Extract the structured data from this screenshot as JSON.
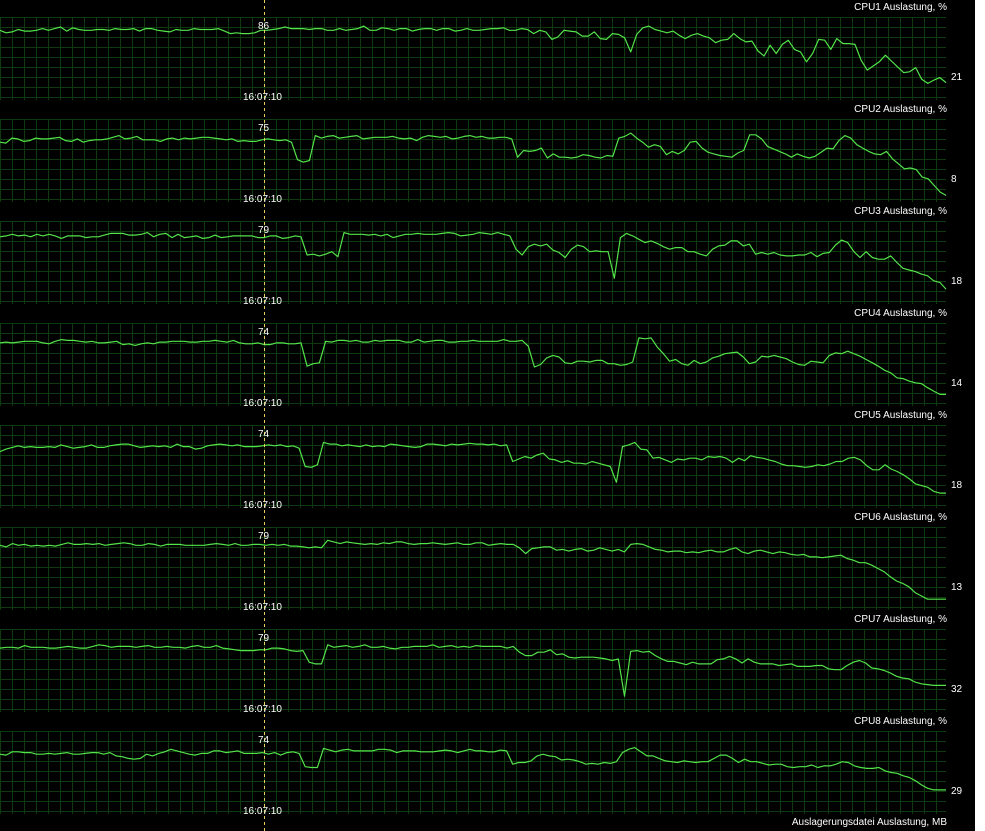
{
  "colors": {
    "background": "#000000",
    "grid": "#0f3a0f",
    "line": "#53e34a",
    "cursor": "#e8d060",
    "text": "#ffffff"
  },
  "cursor_time": "16:07:10",
  "panels": [
    {
      "title": "CPU1 Auslastung, %",
      "cursor_value": "86",
      "current_value": "21",
      "values": [
        84,
        81,
        82,
        85,
        83,
        83,
        84,
        86,
        84,
        86,
        88,
        83,
        87,
        85,
        84,
        84,
        85,
        85,
        84,
        86,
        85,
        85,
        86,
        83,
        86,
        86,
        84,
        83,
        82,
        85,
        84,
        84,
        86,
        85,
        85,
        85,
        86,
        83,
        80,
        81,
        80,
        80,
        81,
        84,
        84,
        85,
        86,
        88,
        86,
        86,
        86,
        85,
        86,
        86,
        84,
        84,
        86,
        84,
        85,
        86,
        89,
        84,
        84,
        87,
        86,
        84,
        86,
        86,
        83,
        85,
        86,
        86,
        84,
        86,
        86,
        83,
        84,
        86,
        84,
        84,
        85,
        86,
        86,
        87,
        84,
        84,
        86,
        85,
        80,
        84,
        82,
        73,
        76,
        84,
        83,
        82,
        77,
        77,
        82,
        74,
        73,
        80,
        79,
        75,
        58,
        79,
        87,
        89,
        85,
        83,
        81,
        83,
        78,
        74,
        78,
        80,
        77,
        75,
        69,
        72,
        73,
        80,
        74,
        70,
        71,
        59,
        53,
        66,
        56,
        67,
        72,
        61,
        58,
        46,
        56,
        73,
        72,
        61,
        74,
        68,
        68,
        67,
        48,
        36,
        41,
        46,
        54,
        47,
        40,
        33,
        34,
        39,
        25,
        20,
        24,
        27,
        21
      ]
    },
    {
      "title": "CPU2 Auslastung, %",
      "cursor_value": "75",
      "current_value": "8",
      "values": [
        72,
        71,
        77,
        76,
        73,
        74,
        77,
        76,
        76,
        77,
        78,
        74,
        73,
        76,
        72,
        74,
        75,
        75,
        76,
        78,
        80,
        76,
        77,
        79,
        75,
        75,
        75,
        73,
        76,
        77,
        75,
        77,
        76,
        77,
        78,
        78,
        77,
        76,
        75,
        76,
        73,
        74,
        73,
        73,
        75,
        76,
        75,
        74,
        75,
        72,
        51,
        48,
        50,
        80,
        77,
        79,
        80,
        77,
        78,
        79,
        80,
        76,
        77,
        78,
        78,
        78,
        79,
        77,
        76,
        77,
        74,
        78,
        80,
        79,
        78,
        79,
        76,
        77,
        79,
        80,
        78,
        79,
        77,
        77,
        78,
        78,
        76,
        54,
        62,
        61,
        62,
        65,
        53,
        58,
        54,
        54,
        53,
        54,
        57,
        56,
        54,
        53,
        56,
        55,
        77,
        79,
        83,
        77,
        72,
        66,
        69,
        67,
        57,
        61,
        58,
        62,
        72,
        73,
        65,
        60,
        58,
        56,
        55,
        54,
        59,
        62,
        81,
        81,
        76,
        67,
        64,
        61,
        58,
        54,
        58,
        55,
        53,
        55,
        60,
        65,
        64,
        74,
        80,
        77,
        69,
        65,
        61,
        58,
        57,
        61,
        52,
        46,
        40,
        41,
        39,
        30,
        28,
        20,
        12,
        8
      ]
    },
    {
      "title": "CPU3 Auslastung, %",
      "cursor_value": "79",
      "current_value": "18",
      "values": [
        81,
        82,
        84,
        82,
        83,
        81,
        84,
        82,
        84,
        82,
        79,
        82,
        82,
        82,
        80,
        81,
        81,
        83,
        85,
        85,
        85,
        83,
        83,
        84,
        86,
        81,
        84,
        85,
        80,
        84,
        80,
        81,
        82,
        79,
        80,
        83,
        80,
        81,
        82,
        82,
        82,
        82,
        80,
        80,
        82,
        82,
        79,
        80,
        82,
        81,
        59,
        60,
        58,
        60,
        63,
        57,
        86,
        84,
        84,
        84,
        83,
        84,
        82,
        84,
        80,
        82,
        84,
        84,
        85,
        84,
        84,
        84,
        85,
        86,
        85,
        82,
        83,
        84,
        86,
        85,
        84,
        86,
        84,
        82,
        66,
        59,
        69,
        72,
        70,
        72,
        65,
        62,
        56,
        66,
        71,
        69,
        63,
        64,
        63,
        63,
        31,
        80,
        85,
        82,
        78,
        74,
        76,
        73,
        69,
        66,
        68,
        68,
        63,
        63,
        60,
        58,
        66,
        70,
        71,
        76,
        76,
        70,
        72,
        60,
        62,
        60,
        62,
        59,
        58,
        58,
        59,
        59,
        62,
        57,
        61,
        62,
        71,
        77,
        74,
        63,
        56,
        63,
        56,
        54,
        54,
        58,
        50,
        43,
        41,
        39,
        36,
        34,
        28,
        26,
        18
      ]
    },
    {
      "title": "CPU4 Auslastung, %",
      "cursor_value": "74",
      "current_value": "14",
      "values": [
        76,
        77,
        76,
        77,
        78,
        78,
        78,
        76,
        75,
        78,
        80,
        79,
        79,
        78,
        77,
        78,
        76,
        76,
        77,
        78,
        74,
        75,
        73,
        75,
        76,
        75,
        77,
        77,
        78,
        78,
        78,
        77,
        77,
        78,
        78,
        79,
        78,
        77,
        79,
        76,
        75,
        75,
        76,
        74,
        74,
        76,
        76,
        75,
        75,
        76,
        48,
        51,
        52,
        78,
        77,
        79,
        79,
        78,
        79,
        77,
        77,
        79,
        78,
        79,
        79,
        79,
        77,
        77,
        80,
        77,
        78,
        79,
        79,
        77,
        77,
        78,
        78,
        79,
        78,
        78,
        78,
        78,
        80,
        78,
        78,
        79,
        72,
        47,
        50,
        58,
        61,
        59,
        52,
        51,
        54,
        54,
        53,
        55,
        55,
        51,
        51,
        49,
        50,
        53,
        82,
        81,
        82,
        71,
        63,
        54,
        56,
        51,
        49,
        55,
        51,
        53,
        58,
        60,
        63,
        64,
        65,
        59,
        51,
        53,
        60,
        59,
        61,
        59,
        57,
        53,
        50,
        49,
        54,
        53,
        52,
        61,
        64,
        63,
        66,
        63,
        60,
        56,
        52,
        48,
        43,
        40,
        34,
        33,
        30,
        28,
        27,
        22,
        18,
        14,
        14
      ]
    },
    {
      "title": "CPU5 Auslastung, %",
      "cursor_value": "74",
      "current_value": "18",
      "values": [
        68,
        71,
        73,
        75,
        73,
        74,
        73,
        73,
        74,
        73,
        76,
        74,
        72,
        73,
        74,
        76,
        73,
        73,
        75,
        76,
        77,
        77,
        75,
        73,
        74,
        75,
        74,
        75,
        73,
        77,
        74,
        74,
        71,
        72,
        75,
        76,
        77,
        76,
        75,
        76,
        74,
        74,
        74,
        75,
        76,
        75,
        76,
        74,
        75,
        72,
        50,
        49,
        52,
        79,
        77,
        77,
        75,
        76,
        75,
        74,
        76,
        74,
        75,
        74,
        77,
        76,
        75,
        74,
        73,
        74,
        77,
        77,
        76,
        75,
        77,
        76,
        77,
        78,
        77,
        77,
        76,
        77,
        75,
        76,
        56,
        59,
        62,
        60,
        64,
        66,
        59,
        58,
        55,
        57,
        54,
        54,
        53,
        56,
        54,
        52,
        50,
        31,
        74,
        76,
        79,
        71,
        70,
        60,
        61,
        58,
        55,
        59,
        58,
        60,
        60,
        58,
        62,
        61,
        62,
        60,
        55,
        60,
        57,
        63,
        61,
        60,
        58,
        56,
        53,
        51,
        51,
        50,
        49,
        50,
        52,
        51,
        53,
        56,
        56,
        60,
        61,
        58,
        51,
        46,
        46,
        52,
        47,
        44,
        40,
        35,
        29,
        27,
        25,
        20,
        18,
        18
      ]
    },
    {
      "title": "CPU6 Auslastung, %",
      "cursor_value": "79",
      "current_value": "13",
      "values": [
        78,
        76,
        80,
        78,
        79,
        77,
        78,
        77,
        78,
        77,
        79,
        81,
        79,
        79,
        80,
        79,
        80,
        78,
        79,
        80,
        81,
        80,
        78,
        78,
        80,
        79,
        77,
        79,
        79,
        79,
        78,
        78,
        78,
        78,
        79,
        80,
        79,
        78,
        80,
        78,
        78,
        79,
        79,
        78,
        79,
        78,
        79,
        77,
        77,
        76,
        75,
        76,
        75,
        84,
        82,
        80,
        82,
        81,
        80,
        79,
        80,
        79,
        81,
        80,
        82,
        82,
        80,
        79,
        80,
        80,
        81,
        80,
        79,
        80,
        81,
        79,
        79,
        81,
        81,
        78,
        79,
        80,
        79,
        79,
        75,
        68,
        74,
        75,
        76,
        76,
        72,
        73,
        71,
        73,
        74,
        71,
        72,
        75,
        73,
        71,
        73,
        70,
        79,
        80,
        79,
        76,
        73,
        72,
        70,
        71,
        71,
        69,
        70,
        69,
        71,
        72,
        70,
        70,
        73,
        75,
        70,
        68,
        71,
        72,
        70,
        68,
        70,
        69,
        67,
        66,
        67,
        64,
        64,
        63,
        64,
        65,
        66,
        62,
        60,
        57,
        57,
        54,
        50,
        46,
        40,
        35,
        32,
        28,
        21,
        17,
        13,
        13,
        13,
        13
      ]
    },
    {
      "title": "CPU7 Auslastung, %",
      "cursor_value": "79",
      "current_value": "32",
      "values": [
        77,
        78,
        78,
        77,
        80,
        78,
        78,
        78,
        77,
        77,
        78,
        79,
        78,
        77,
        77,
        79,
        81,
        80,
        78,
        79,
        79,
        79,
        78,
        79,
        80,
        78,
        78,
        79,
        78,
        78,
        77,
        79,
        80,
        78,
        78,
        80,
        77,
        76,
        75,
        74,
        74,
        74,
        75,
        75,
        77,
        77,
        76,
        74,
        73,
        74,
        60,
        58,
        58,
        81,
        78,
        79,
        80,
        78,
        79,
        81,
        78,
        78,
        79,
        77,
        76,
        78,
        78,
        79,
        79,
        79,
        81,
        78,
        79,
        80,
        78,
        79,
        78,
        80,
        79,
        79,
        79,
        79,
        77,
        79,
        72,
        68,
        68,
        72,
        72,
        75,
        69,
        70,
        66,
        65,
        66,
        66,
        66,
        65,
        64,
        62,
        64,
        19,
        73,
        74,
        72,
        73,
        68,
        64,
        61,
        61,
        59,
        57,
        60,
        58,
        58,
        58,
        63,
        64,
        67,
        64,
        59,
        64,
        60,
        58,
        58,
        58,
        56,
        57,
        58,
        55,
        55,
        55,
        56,
        56,
        52,
        51,
        51,
        56,
        60,
        62,
        59,
        53,
        52,
        50,
        47,
        43,
        41,
        40,
        36,
        34,
        33,
        32,
        32,
        32
      ]
    },
    {
      "title": "CPU8 Auslastung, %",
      "cursor_value": "74",
      "current_value": "29",
      "values": [
        72,
        71,
        75,
        75,
        74,
        74,
        72,
        72,
        73,
        72,
        73,
        74,
        72,
        72,
        73,
        74,
        74,
        72,
        74,
        70,
        69,
        67,
        66,
        67,
        72,
        70,
        73,
        75,
        78,
        76,
        74,
        72,
        71,
        73,
        73,
        76,
        76,
        74,
        75,
        76,
        73,
        73,
        73,
        74,
        72,
        74,
        71,
        74,
        75,
        73,
        57,
        56,
        56,
        79,
        77,
        75,
        77,
        78,
        76,
        76,
        76,
        76,
        78,
        78,
        77,
        74,
        76,
        76,
        76,
        75,
        75,
        75,
        76,
        77,
        76,
        74,
        76,
        78,
        76,
        76,
        75,
        75,
        77,
        76,
        60,
        62,
        62,
        64,
        70,
        72,
        70,
        69,
        65,
        66,
        65,
        63,
        60,
        61,
        60,
        62,
        61,
        63,
        74,
        78,
        80,
        75,
        70,
        70,
        67,
        64,
        63,
        62,
        64,
        63,
        62,
        63,
        63,
        67,
        71,
        71,
        67,
        62,
        66,
        63,
        63,
        61,
        59,
        60,
        60,
        57,
        56,
        57,
        57,
        59,
        56,
        58,
        58,
        60,
        63,
        62,
        58,
        56,
        55,
        55,
        56,
        52,
        50,
        49,
        46,
        44,
        40,
        35,
        31,
        29,
        29,
        29
      ]
    }
  ],
  "footer_title": "Auslagerungsdatei Auslastung, MB"
}
